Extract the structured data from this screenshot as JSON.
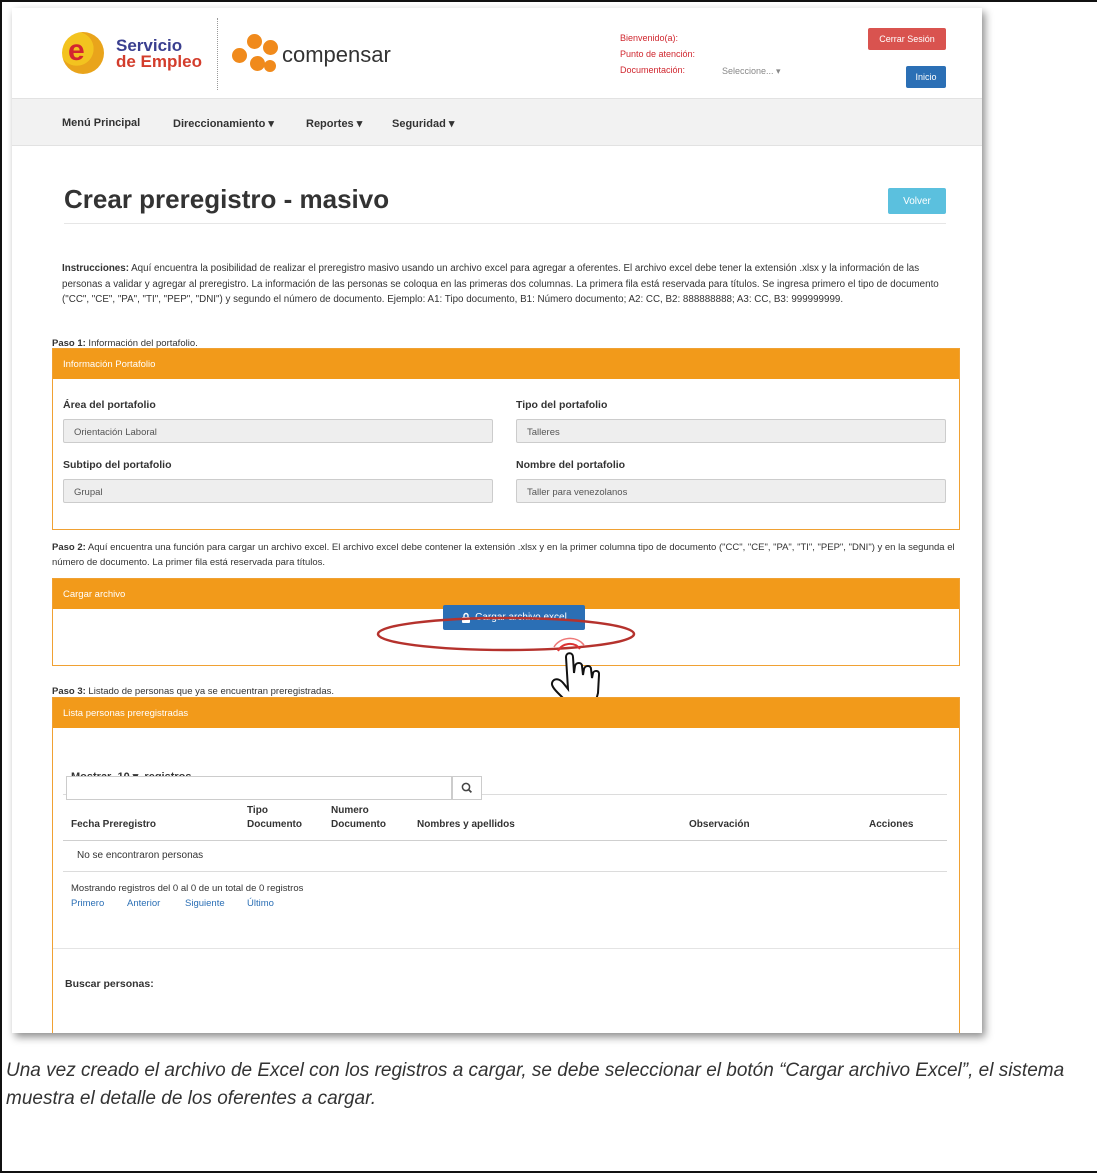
{
  "header": {
    "logo_servicio_line1": "Servicio",
    "logo_servicio_line2": "de Empleo",
    "logo_e_letter": "e",
    "logo_compensar": "compensar",
    "bienvenido_label": "Bienvenido(a):",
    "punto_label": "Punto de atención:",
    "documentacion_label": "Documentación:",
    "documentacion_select": "Seleccione... ▾",
    "cerrar_sesion": "Cerrar Sesión",
    "inicio": "Inicio"
  },
  "nav": {
    "items": [
      "Menú Principal",
      "Direccionamiento ▾",
      "Reportes ▾",
      "Seguridad ▾"
    ]
  },
  "page": {
    "title": "Crear preregistro - masivo",
    "volver": "Volver",
    "instructions_bold": "Instrucciones:",
    "instructions_text": " Aquí encuentra la posibilidad de realizar el preregistro masivo usando un archivo excel para agregar a oferentes. El archivo excel debe tener la extensión .xlsx y la información de las personas a validar y agregar al preregistro. La información de las personas se coloqua en las primeras dos columnas. La primera fila está reservada para títulos. Se ingresa primero el tipo de documento (\"CC\", \"CE\", \"PA\", \"TI\", \"PEP\", \"DNI\") y segundo el número de documento. Ejemplo: A1: Tipo documento, B1: Número documento; A2: CC, B2: 888888888; A3: CC, B3: 999999999."
  },
  "paso1": {
    "label_bold": "Paso 1:",
    "label_text": " Información del portafolio.",
    "panel_title": "Información Portafolio",
    "fields": [
      {
        "label": "Área del portafolio",
        "value": "Orientación Laboral"
      },
      {
        "label": "Tipo del portafolio",
        "value": "Talleres"
      },
      {
        "label": "Subtipo del portafolio",
        "value": "Grupal"
      },
      {
        "label": "Nombre del portafolio",
        "value": "Taller para venezolanos"
      }
    ]
  },
  "paso2": {
    "label_bold": "Paso 2:",
    "label_text": " Aquí encuentra una función para cargar un archivo excel. El archivo excel debe contener la extensión .xlsx y en la primer columna tipo de documento (\"CC\", \"CE\", \"PA\", \"TI\", \"PEP\", \"DNI\") y en la segunda el número de documento. La primer fila está reservada para títulos.",
    "panel_title": "Cargar archivo",
    "button": "Cargar archivo excel"
  },
  "paso3": {
    "label_bold": "Paso 3:",
    "label_text": " Listado de personas que ya se encuentran preregistradas.",
    "panel_title": "Lista personas preregistradas",
    "mostrar_prefix": "Mostrar",
    "mostrar_value": "10 ▾",
    "mostrar_suffix": "registros",
    "columns": [
      "Fecha Preregistro",
      "Tipo Documento",
      "Numero Documento",
      "Nombres y apellidos",
      "Observación",
      "Acciones"
    ],
    "empty_text": "No se encontraron personas",
    "info_text": "Mostrando registros del 0 al 0 de un total de 0 registros",
    "pager": [
      "Primero",
      "Anterior",
      "Siguiente",
      "Último"
    ],
    "buscar_label": "Buscar personas:",
    "search_value": ""
  },
  "caption": "Una vez creado el archivo de Excel con los registros a cargar, se debe seleccionar el botón “Cargar archivo Excel”, el sistema muestra el detalle de los oferentes a cargar.",
  "colors": {
    "orange": "#f29a1a",
    "blue": "#2b6fb5",
    "red": "#d9534f",
    "cyan": "#5bc0de"
  },
  "icons": [
    "lock-icon",
    "search-icon",
    "hand-pointer-icon"
  ]
}
